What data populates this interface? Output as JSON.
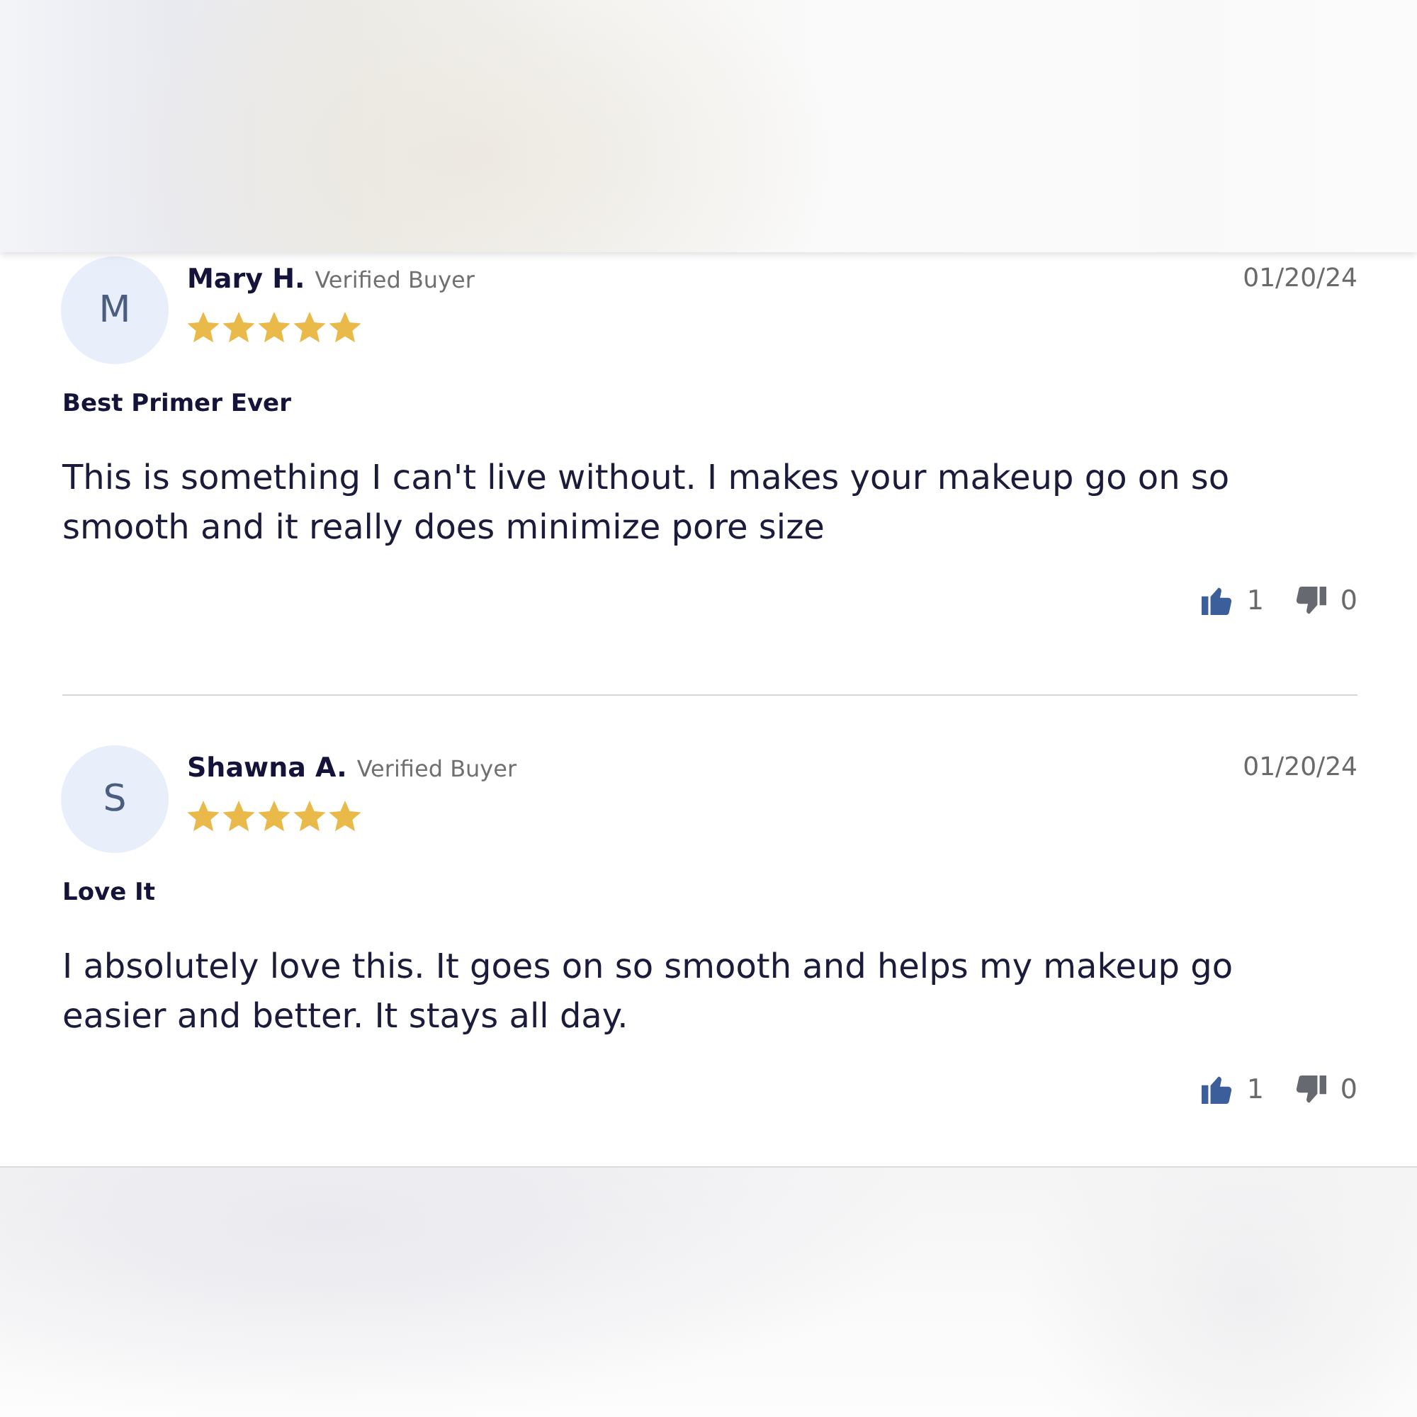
{
  "reviews": [
    {
      "avatar_initial": "M",
      "name": "Mary H.",
      "badge": "Verified Buyer",
      "stars": 5,
      "date": "01/20/24",
      "title": "Best Primer Ever",
      "body": "This is something I can't live without. I makes your makeup go on so smooth and it really does minimize pore size",
      "helpful_count": "1",
      "unhelpful_count": "0"
    },
    {
      "avatar_initial": "S",
      "name": "Shawna A.",
      "badge": "Verified Buyer",
      "stars": 5,
      "date": "01/20/24",
      "title": "Love It",
      "body": "I absolutely love this. It goes on so smooth and helps my makeup go easier and better. It stays all day.",
      "helpful_count": "1",
      "unhelpful_count": "0"
    }
  ]
}
